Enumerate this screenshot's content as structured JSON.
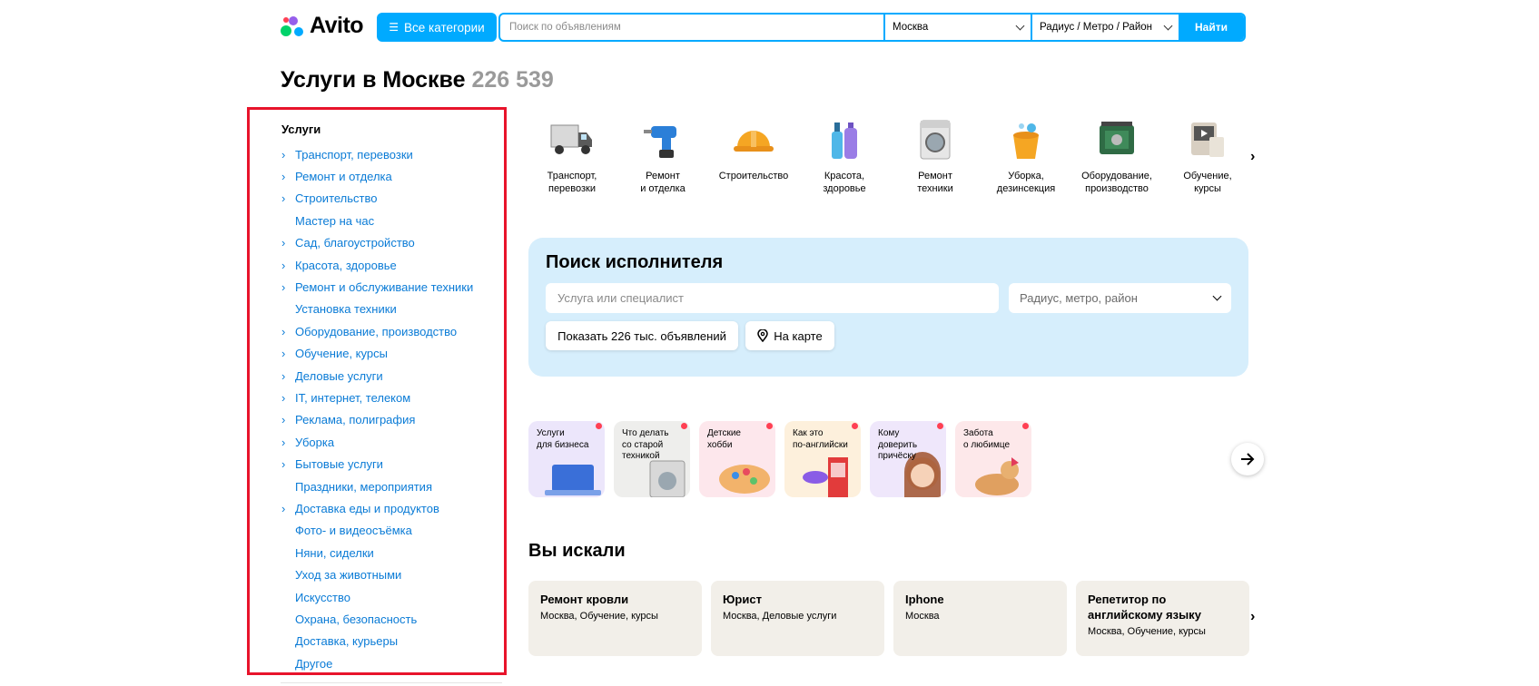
{
  "header": {
    "logo_text": "Avito",
    "categories_button": "Все категории",
    "search_placeholder": "Поиск по объявлениям",
    "city": "Москва",
    "radius": "Радиус / Метро / Район",
    "find_button": "Найти"
  },
  "page": {
    "title": "Услуги в Москве",
    "count": "226 539"
  },
  "sidebar": {
    "heading": "Услуги",
    "items": [
      {
        "label": "Транспорт, перевозки",
        "arrow": "›"
      },
      {
        "label": "Ремонт и отделка",
        "arrow": "›"
      },
      {
        "label": "Строительство",
        "arrow": "›"
      },
      {
        "label": "Мастер на час",
        "arrow": ""
      },
      {
        "label": "Сад, благоустройство",
        "arrow": "›"
      },
      {
        "label": "Красота, здоровье",
        "arrow": "›"
      },
      {
        "label": "Ремонт и обслуживание техники",
        "arrow": "›"
      },
      {
        "label": "Установка техники",
        "arrow": ""
      },
      {
        "label": "Оборудование, производство",
        "arrow": "›"
      },
      {
        "label": "Обучение, курсы",
        "arrow": "›"
      },
      {
        "label": "Деловые услуги",
        "arrow": "›"
      },
      {
        "label": "IT, интернет, телеком",
        "arrow": "›"
      },
      {
        "label": "Реклама, полиграфия",
        "arrow": "›"
      },
      {
        "label": "Уборка",
        "arrow": "›"
      },
      {
        "label": "Бытовые услуги",
        "arrow": "›"
      },
      {
        "label": "Праздники, мероприятия",
        "arrow": ""
      },
      {
        "label": "Доставка еды и продуктов",
        "arrow": "›"
      },
      {
        "label": "Фото- и видеосъёмка",
        "arrow": ""
      },
      {
        "label": "Няни, сиделки",
        "arrow": ""
      },
      {
        "label": "Уход за животными",
        "arrow": ""
      },
      {
        "label": "Искусство",
        "arrow": ""
      },
      {
        "label": "Охрана, безопасность",
        "arrow": ""
      },
      {
        "label": "Доставка, курьеры",
        "arrow": ""
      },
      {
        "label": "Другое",
        "arrow": ""
      }
    ]
  },
  "categories": [
    {
      "label": "Транспорт,\nперевозки",
      "icon": "truck-icon"
    },
    {
      "label": "Ремонт\nи отделка",
      "icon": "drill-icon"
    },
    {
      "label": "Строительство",
      "icon": "helmet-icon"
    },
    {
      "label": "Красота,\nздоровье",
      "icon": "cosmetics-icon"
    },
    {
      "label": "Ремонт\nтехники",
      "icon": "washing-machine-icon"
    },
    {
      "label": "Уборка,\nдезинсекция",
      "icon": "bucket-icon"
    },
    {
      "label": "Оборудование,\nпроизводство",
      "icon": "generator-icon"
    },
    {
      "label": "Обучение,\nкурсы",
      "icon": "tablet-icon"
    }
  ],
  "performer_search": {
    "title": "Поиск исполнителя",
    "service_placeholder": "Услуга или специалист",
    "radius_placeholder": "Радиус, метро, район",
    "show_button": "Показать 226 тыс. объявлений",
    "map_button": "На карте"
  },
  "stories": [
    {
      "text": "Услуги\nдля бизнеса",
      "bg": "#ece6fb"
    },
    {
      "text": "Что делать\nсо старой\nтехникой",
      "bg": "#eeeeec"
    },
    {
      "text": "Детские\nхобби",
      "bg": "#fde7ec"
    },
    {
      "text": "Как это\nпо-английски",
      "bg": "#fdf0dc"
    },
    {
      "text": "Кому\nдоверить\nпричёску",
      "bg": "#efe7fb"
    },
    {
      "text": "Забота\nо любимце",
      "bg": "#fde8ea"
    }
  ],
  "you_searched": {
    "title": "Вы искали",
    "cards": [
      {
        "query": "Ремонт кровли",
        "meta": "Москва, Обучение, курсы"
      },
      {
        "query": "Юрист",
        "meta": "Москва, Деловые услуги"
      },
      {
        "query": "Iphone",
        "meta": "Москва"
      },
      {
        "query": "Репетитор по английскому языку",
        "meta": "Москва, Обучение, курсы"
      }
    ]
  },
  "colors": {
    "accent": "#00aaff",
    "link": "#0a7bd6",
    "highlight": "#e8132b",
    "panel": "#d6eefc"
  }
}
